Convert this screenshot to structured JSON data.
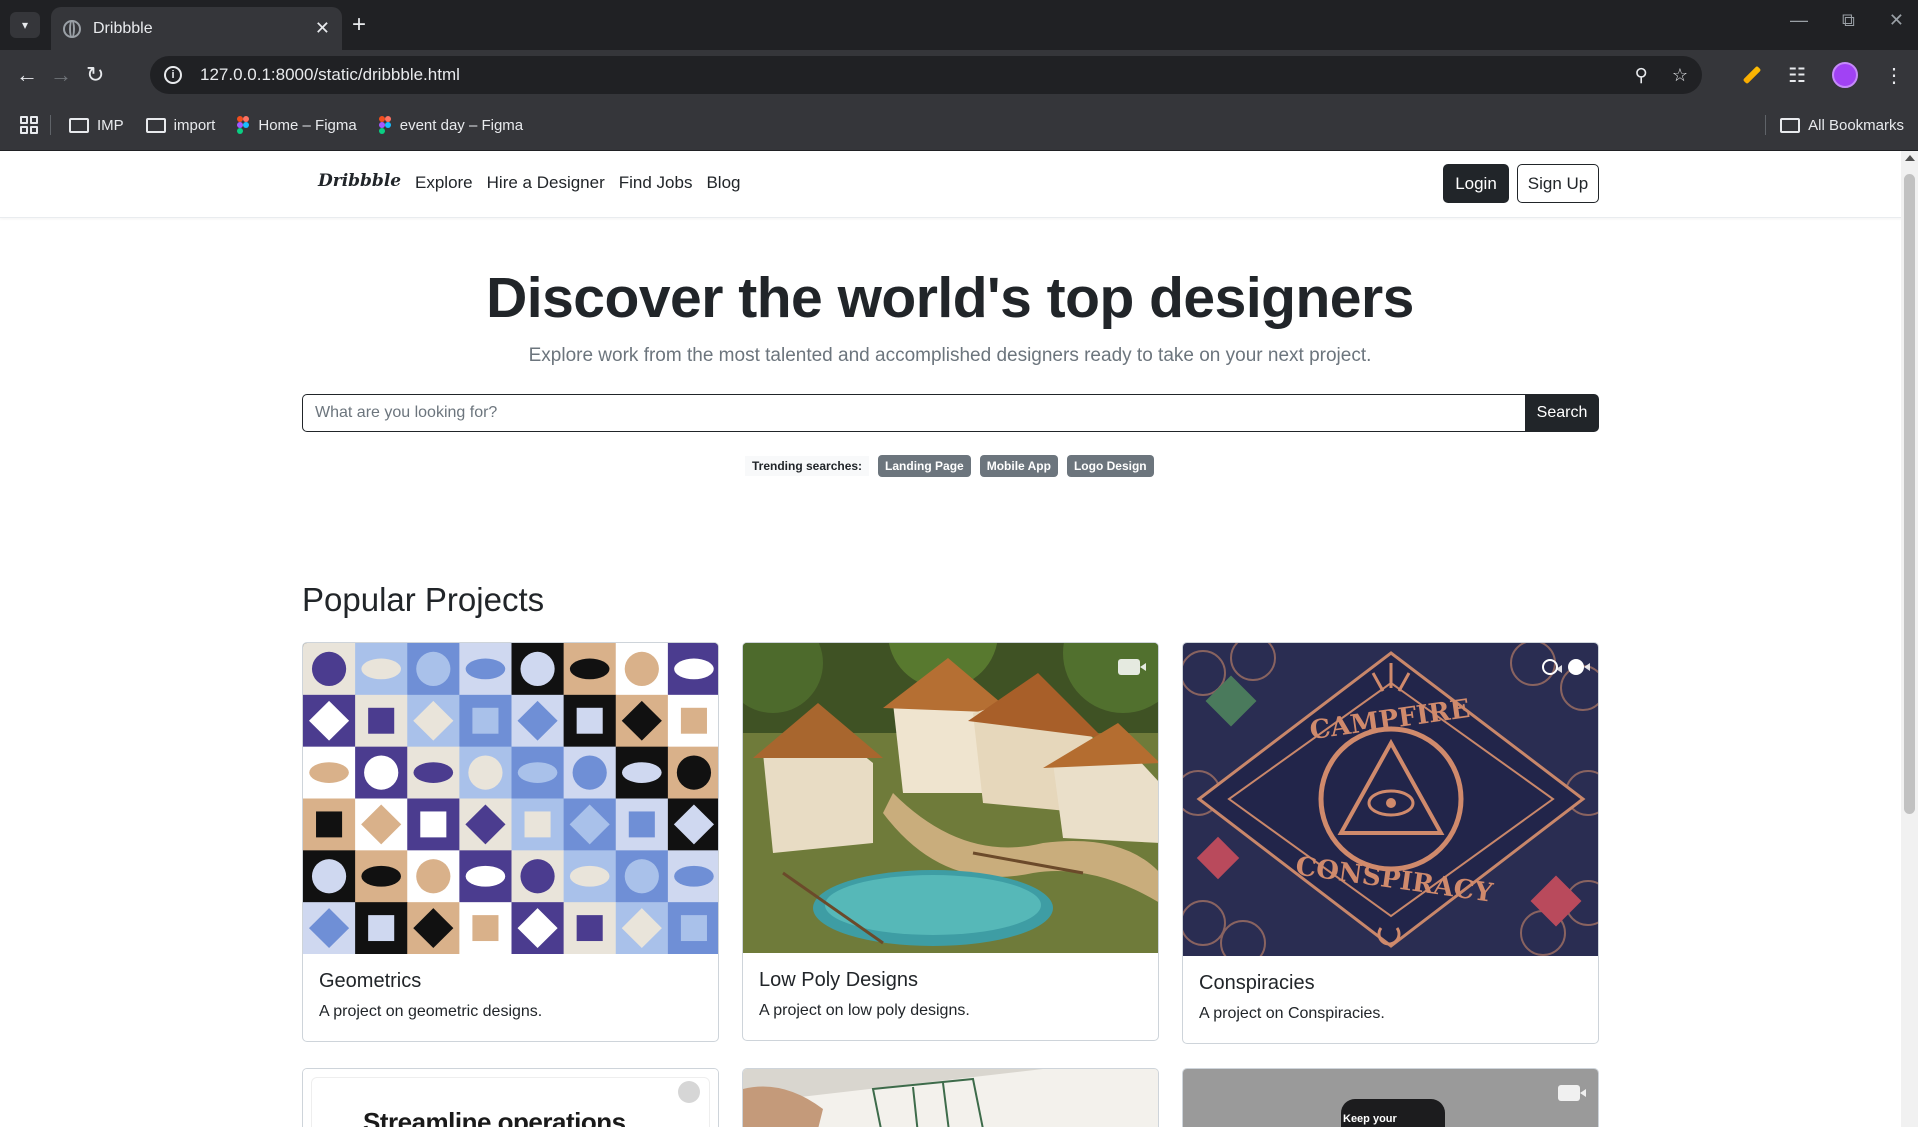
{
  "browser": {
    "tab_title": "Dribbble",
    "url": "127.0.0.1:8000/static/dribbble.html",
    "bookmarks": [
      {
        "label": "IMP",
        "icon": "folder-icon"
      },
      {
        "label": "import",
        "icon": "folder-icon"
      },
      {
        "label": "Home – Figma",
        "icon": "figma-icon"
      },
      {
        "label": "event day – Figma",
        "icon": "figma-icon"
      }
    ],
    "all_bookmarks": "All Bookmarks"
  },
  "site": {
    "logo": "Dribbble",
    "nav": [
      "Explore",
      "Hire a Designer",
      "Find Jobs",
      "Blog"
    ],
    "login": "Login",
    "signup": "Sign Up"
  },
  "hero": {
    "title": "Discover the world's top designers",
    "subtitle": "Explore work from the most talented and accomplished designers ready to take on your next project.",
    "search_placeholder": "What are you looking for?",
    "search_button": "Search",
    "trending_label": "Trending searches:",
    "trending": [
      "Landing Page",
      "Mobile App",
      "Logo Design"
    ]
  },
  "projects": {
    "heading": "Popular Projects",
    "cards": [
      {
        "title": "Geometrics",
        "text": "A project on geometric designs."
      },
      {
        "title": "Low Poly Designs",
        "text": "A project on low poly designs."
      },
      {
        "title": "Conspiracies",
        "text": "A project on Conspiracies."
      }
    ],
    "second_row": [
      {
        "visible_text": "Streamline operations"
      },
      {
        "visible_text": ""
      },
      {
        "visible_text": "Keep your"
      }
    ]
  },
  "colors": {
    "dark": "#212529",
    "muted": "#6c757d",
    "border": "#ced4da",
    "chrome_dark": "#202124",
    "chrome": "#35363a"
  }
}
